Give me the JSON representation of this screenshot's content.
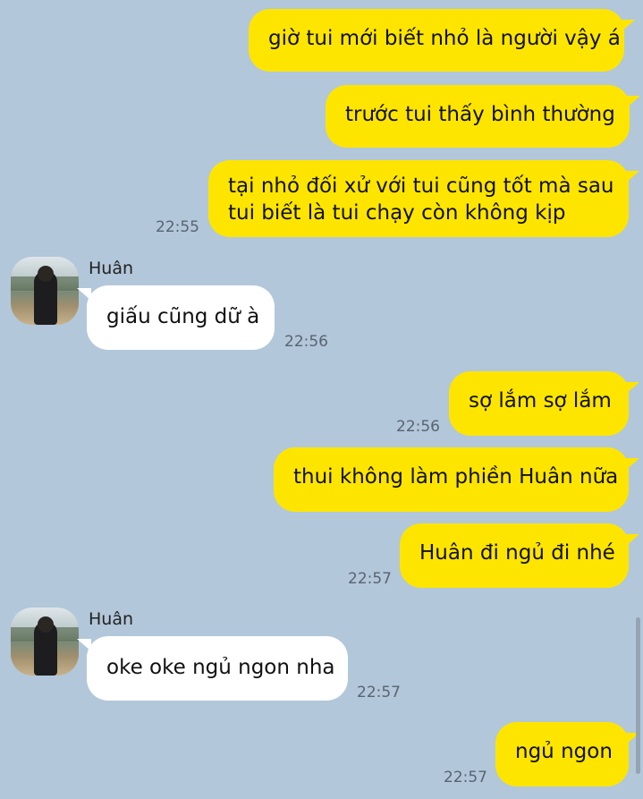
{
  "messages": [
    {
      "dir": "out",
      "text": "giờ tui mới biết nhỏ là người vậy á"
    },
    {
      "dir": "out",
      "text": "trước tui thấy bình thường"
    },
    {
      "dir": "out",
      "line1": "tại nhỏ đối xử với tui cũng tốt mà sau",
      "line2": "tui biết là tui chạy còn không kịp",
      "time": "22:55"
    },
    {
      "dir": "in",
      "sender": "Huân",
      "text": "giấu cũng dữ à",
      "time": "22:56"
    },
    {
      "dir": "out",
      "text": "sợ lắm sợ lắm",
      "time": "22:56"
    },
    {
      "dir": "out",
      "text": "thui không làm phiền Huân nữa"
    },
    {
      "dir": "out",
      "text": "Huân đi ngủ đi nhé",
      "time": "22:57"
    },
    {
      "dir": "in",
      "sender": "Huân",
      "text": "oke oke ngủ ngon nha",
      "time": "22:57"
    },
    {
      "dir": "out",
      "text": "ngủ ngon",
      "time": "22:57"
    }
  ],
  "colors": {
    "background": "#b2c7da",
    "outgoing_bubble": "#fee500",
    "incoming_bubble": "#ffffff",
    "timestamp": "#5a6470"
  }
}
